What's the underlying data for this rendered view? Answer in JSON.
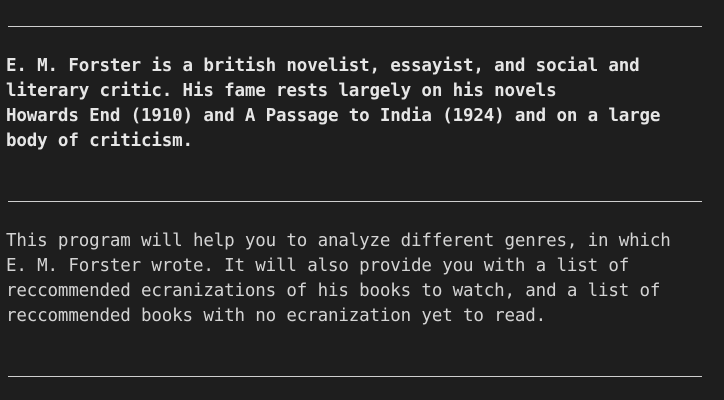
{
  "terminal": {
    "bio_lines": [
      "E. M. Forster is a british novelist, essayist, and social and",
      "literary critic. His fame rests largely on his novels",
      "Howards End (1910) and A Passage to India (1924) and on a large",
      "body of criticism."
    ],
    "intro_lines": [
      "This program will help you to analyze different genres, in which",
      "E. M. Forster wrote. It will also provide you with a list of",
      "reccommended ecranizations of his books to watch, and a list of",
      "reccommended books with no ecranization yet to read."
    ]
  }
}
